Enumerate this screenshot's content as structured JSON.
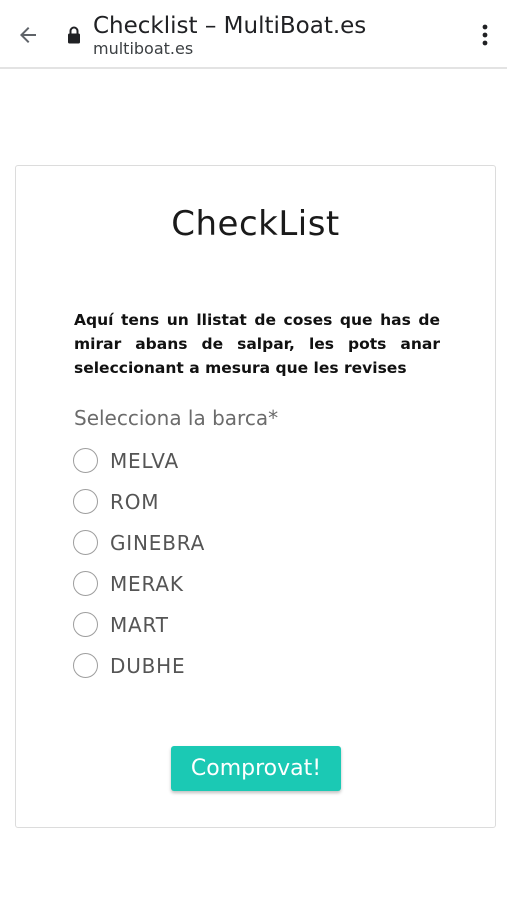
{
  "browser": {
    "page_title": "Checklist – MultiBoat.es",
    "url": "multiboat.es",
    "back_icon": "arrow-left",
    "lock_icon": "lock",
    "menu_icon": "vertical-ellipsis"
  },
  "form": {
    "title": "CheckList",
    "description": "Aquí tens un llistat de coses que has de mirar abans de salpar, les pots anar seleccionant a mesura que les revises",
    "question": "Selecciona la barca*",
    "options": [
      "MELVA",
      "ROM",
      "GINEBRA",
      "MERAK",
      "MART",
      "DUBHE"
    ],
    "selected": null,
    "submit_label": "Comprovat!"
  },
  "colors": {
    "accent": "#1bc9b4",
    "text": "#1a1a1a",
    "muted": "#6b6b6b"
  }
}
